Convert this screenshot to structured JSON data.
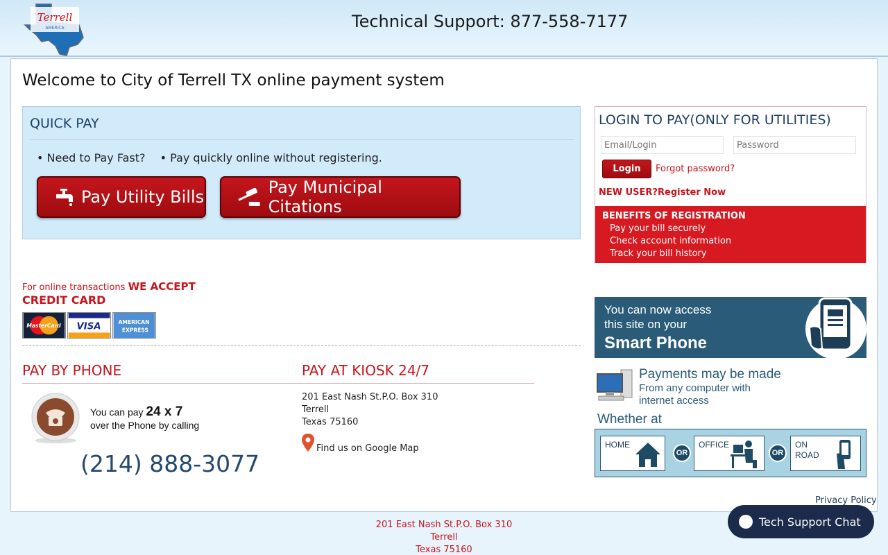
{
  "header": {
    "logo_text": "Terrell",
    "logo_subtext": "AMERICA",
    "support_text": "Technical Support: 877-558-7177"
  },
  "main": {
    "welcome": "Welcome to City of Terrell TX online payment system"
  },
  "quick_pay": {
    "title": "QUICK PAY",
    "bullet1": "• Need to Pay Fast?",
    "bullet2": "• Pay quickly online without registering.",
    "utility_button": "Pay Utility Bills",
    "citation_button": "Pay Municipal Citations"
  },
  "login": {
    "title": "LOGIN TO PAY(ONLY FOR UTILITIES)",
    "email_placeholder": "Email/Login",
    "password_placeholder": "Password",
    "login_button": "Login",
    "forgot": "Forgot password?",
    "new_user": "NEW USER?",
    "register": "Register Now",
    "benefits_title": "BENEFITS OF REGISTRATION",
    "benefits": [
      "Pay your bill securely",
      "Check account information",
      "Track your bill history"
    ]
  },
  "credit": {
    "small": "For online transactions",
    "accept": "WE ACCEPT",
    "card": "CREDIT CARD",
    "cards": [
      "MasterCard",
      "VISA",
      "AMERICAN EXPRESS"
    ]
  },
  "phone": {
    "title": "PAY BY PHONE",
    "line1_prefix": "You can pay",
    "line1_bold": "24 x 7",
    "line2": "over the Phone by calling",
    "number": "(214) 888-3077"
  },
  "kiosk": {
    "title": "PAY AT KIOSK 24/7",
    "address": [
      "201 East Nash St.P.O. Box 310",
      "Terrell",
      "Texas 75160"
    ],
    "map_link": "Find us on Google Map"
  },
  "smartphone": {
    "line1": "You can now access",
    "line2": "this site on your",
    "line3": "Smart Phone"
  },
  "payments": {
    "title": "Payments may be made",
    "sub1": "From any computer with",
    "sub2": "internet access",
    "whether": "Whether at",
    "home": "HOME",
    "office": "OFFICE",
    "road1": "ON",
    "road2": "ROAD",
    "or": "OR"
  },
  "privacy": "Privacy Policy",
  "footer": {
    "address": [
      "201 East Nash St.P.O. Box 310",
      "Terrell",
      "Texas 75160"
    ]
  },
  "chat": {
    "label": "Tech Support Chat"
  },
  "colors": {
    "brand_red": "#c8141b",
    "navy": "#1e3f66",
    "teal": "#2a5b78"
  }
}
